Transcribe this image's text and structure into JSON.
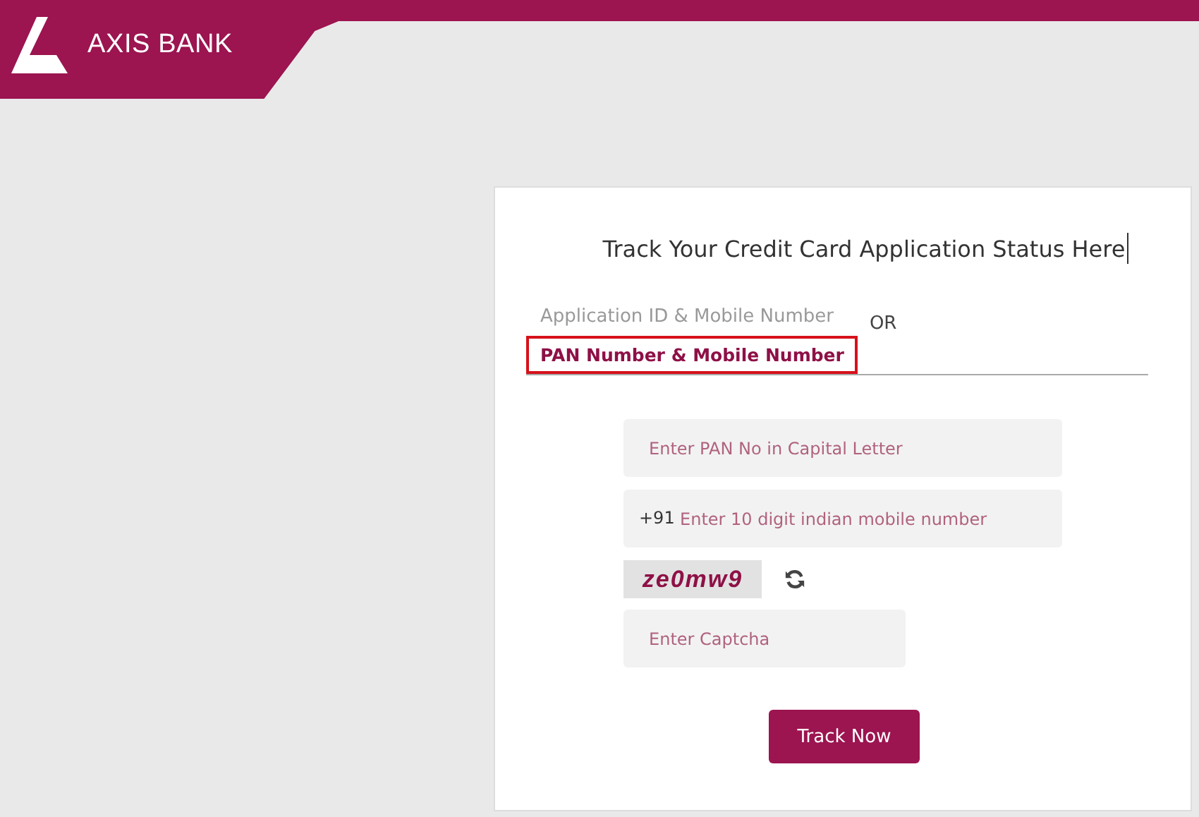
{
  "header": {
    "logo_text": "AXIS BANK"
  },
  "form": {
    "title": "Track Your Credit Card Application Status Here",
    "tabs": [
      {
        "label": "Application ID & Mobile Number",
        "selected": false
      },
      {
        "label": "PAN Number & Mobile Number",
        "selected": true
      }
    ],
    "separator": "OR",
    "pan_field": {
      "placeholder": "Enter PAN No in Capital Letter"
    },
    "mobile_field": {
      "prefix": "+91",
      "placeholder": "Enter 10 digit indian mobile number"
    },
    "captcha": {
      "text": "ze0mw9"
    },
    "captcha_field": {
      "placeholder": "Enter Captcha"
    },
    "submit_button": "Track Now"
  }
}
